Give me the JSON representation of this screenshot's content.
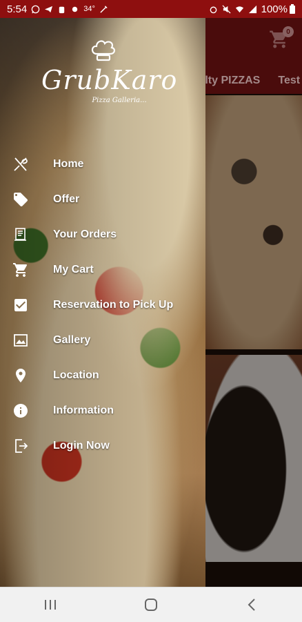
{
  "status_bar": {
    "time": "5:54",
    "temperature": "34°",
    "battery": "100%"
  },
  "app": {
    "cart_count": "0",
    "tabs": [
      "ialty PIZZAS",
      "Test"
    ]
  },
  "drawer": {
    "logo_title": "GrubKaro",
    "logo_subtitle": "Pizza Galleria...",
    "items": [
      {
        "label": "Home",
        "icon": "fork-knife-icon"
      },
      {
        "label": "Offer",
        "icon": "tag-icon"
      },
      {
        "label": "Your Orders",
        "icon": "receipt-icon"
      },
      {
        "label": "My Cart",
        "icon": "cart-icon"
      },
      {
        "label": "Reservation to Pick Up",
        "icon": "checkbox-icon"
      },
      {
        "label": "Gallery",
        "icon": "image-icon"
      },
      {
        "label": "Location",
        "icon": "location-pin-icon"
      },
      {
        "label": "Information",
        "icon": "info-icon"
      },
      {
        "label": "Login Now",
        "icon": "login-icon"
      }
    ]
  },
  "colors": {
    "status_bar": "#8e0f0f",
    "header": "#6d1212"
  }
}
